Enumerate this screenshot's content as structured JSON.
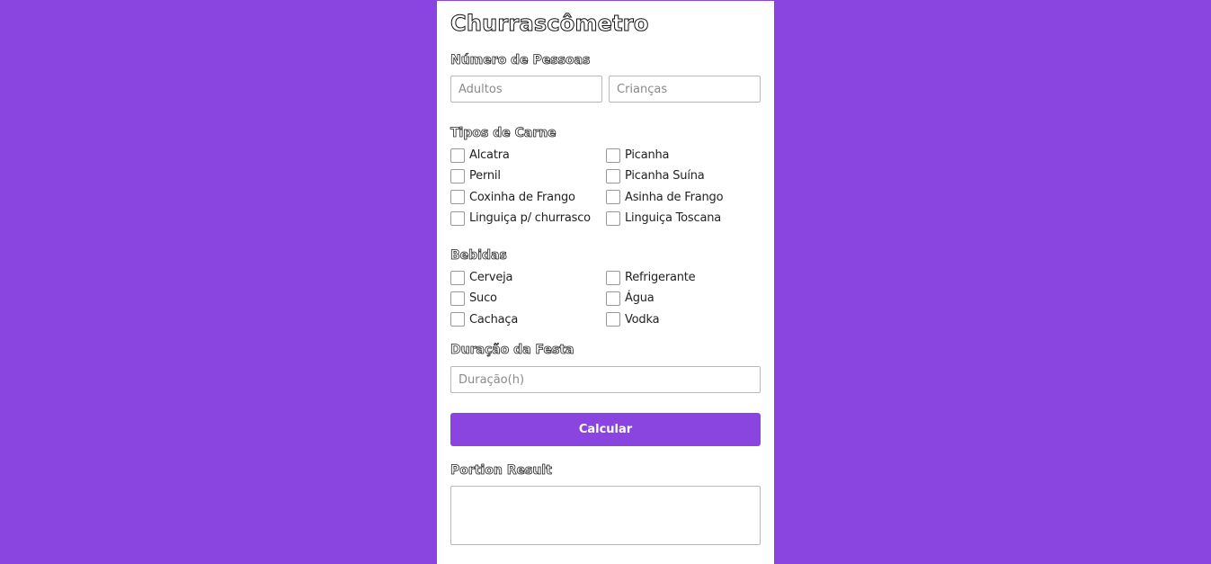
{
  "app": {
    "title": "Churrascômetro"
  },
  "people": {
    "label": "Número de Pessoas",
    "adults_placeholder": "Adultos",
    "children_placeholder": "Crianças"
  },
  "meats": {
    "label": "Tipos de Carne",
    "items": [
      {
        "label": "Alcatra"
      },
      {
        "label": "Picanha"
      },
      {
        "label": "Pernil"
      },
      {
        "label": "Picanha Suína"
      },
      {
        "label": "Coxinha de Frango"
      },
      {
        "label": "Asinha de Frango"
      },
      {
        "label": "Linguiça p/ churrasco"
      },
      {
        "label": "Linguiça Toscana"
      }
    ]
  },
  "drinks": {
    "label": "Bebidas",
    "items": [
      {
        "label": "Cerveja"
      },
      {
        "label": "Refrigerante"
      },
      {
        "label": "Suco"
      },
      {
        "label": "Água"
      },
      {
        "label": "Cachaça"
      },
      {
        "label": "Vodka"
      }
    ]
  },
  "duration": {
    "label": "Duração da Festa",
    "placeholder": "Duração(h)"
  },
  "actions": {
    "calculate_label": "Calcular"
  },
  "result": {
    "label": "Portion Result",
    "value": ""
  },
  "colors": {
    "accent": "#8a45e0",
    "card": "#ffffff"
  }
}
